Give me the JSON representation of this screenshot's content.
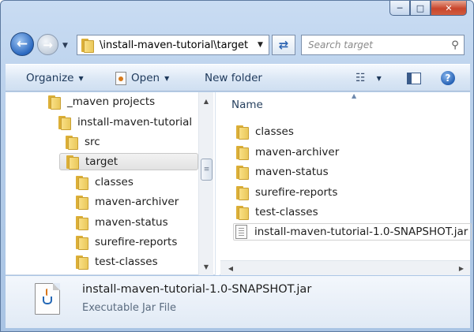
{
  "address": {
    "path": "\\install-maven-tutorial\\target",
    "search_placeholder": "Search target"
  },
  "toolbar": {
    "organize": "Organize",
    "open": "Open",
    "new_folder": "New folder"
  },
  "tree": {
    "items": [
      {
        "label": "_maven projects"
      },
      {
        "label": "install-maven-tutorial"
      },
      {
        "label": "src"
      },
      {
        "label": "target",
        "selected": true
      },
      {
        "label": "classes"
      },
      {
        "label": "maven-archiver"
      },
      {
        "label": "maven-status"
      },
      {
        "label": "surefire-reports"
      },
      {
        "label": "test-classes"
      }
    ]
  },
  "list": {
    "column_name": "Name",
    "items": [
      {
        "label": "classes",
        "type": "folder"
      },
      {
        "label": "maven-archiver",
        "type": "folder"
      },
      {
        "label": "maven-status",
        "type": "folder"
      },
      {
        "label": "surefire-reports",
        "type": "folder"
      },
      {
        "label": "test-classes",
        "type": "folder"
      },
      {
        "label": "install-maven-tutorial-1.0-SNAPSHOT.jar",
        "type": "jar"
      }
    ]
  },
  "details": {
    "file_name": "install-maven-tutorial-1.0-SNAPSHOT.jar",
    "file_type": "Executable Jar File"
  },
  "colors": {
    "chrome": "#b5cde9",
    "selection": "#e2e2e2",
    "close": "#c8452c"
  }
}
